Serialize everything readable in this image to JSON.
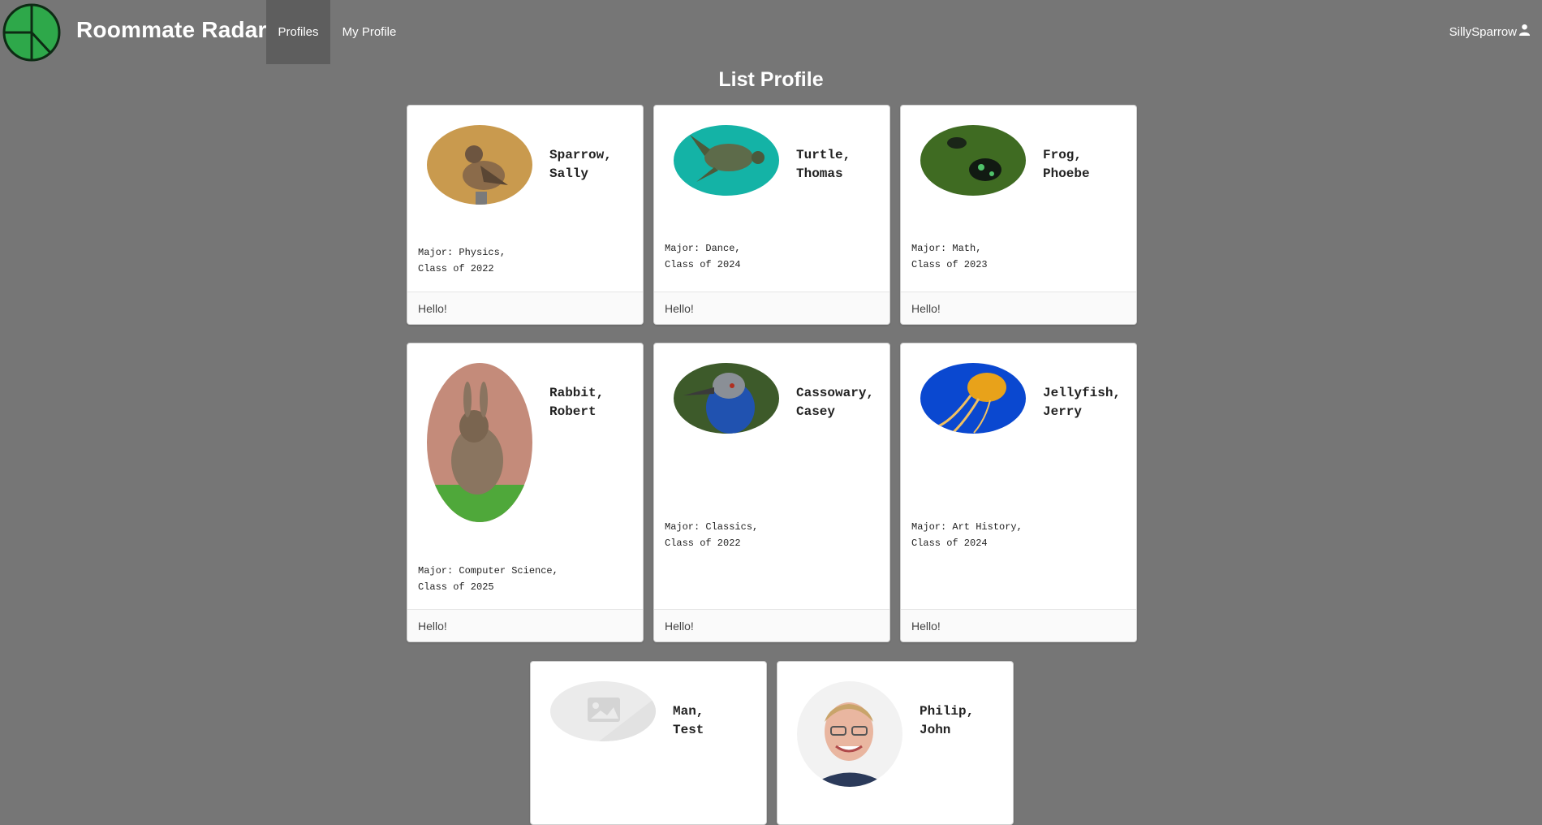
{
  "app": {
    "brand": "Roommate Radar",
    "nav": {
      "profiles": "Profiles",
      "my_profile": "My Profile"
    },
    "user": {
      "name": "SillySparrow"
    }
  },
  "page": {
    "title": "List Profile"
  },
  "profiles": [
    {
      "name_line1": "Sparrow,",
      "name_line2": "Sally",
      "desc_line1": "Major: Physics,",
      "desc_line2": "Class of 2022",
      "footer": "Hello!",
      "image": "sparrow"
    },
    {
      "name_line1": "Turtle,",
      "name_line2": "Thomas",
      "desc_line1": "Major: Dance,",
      "desc_line2": "Class of 2024",
      "footer": "Hello!",
      "image": "turtle"
    },
    {
      "name_line1": "Frog,",
      "name_line2": "Phoebe",
      "desc_line1": "Major: Math,",
      "desc_line2": "Class of 2023",
      "footer": "Hello!",
      "image": "frog"
    },
    {
      "name_line1": "Rabbit,",
      "name_line2": "Robert",
      "desc_line1": "Major: Computer Science,",
      "desc_line2": "Class of 2025",
      "footer": "Hello!",
      "image": "rabbit"
    },
    {
      "name_line1": "Cassowary,",
      "name_line2": "Casey",
      "desc_line1": "Major: Classics,",
      "desc_line2": "Class of 2022",
      "footer": "Hello!",
      "image": "cassowary"
    },
    {
      "name_line1": "Jellyfish,",
      "name_line2": "Jerry",
      "desc_line1": "Major: Art History,",
      "desc_line2": "Class of 2024",
      "footer": "Hello!",
      "image": "jellyfish"
    },
    {
      "name_line1": "Man,",
      "name_line2": "Test",
      "image": "placeholder"
    },
    {
      "name_line1": "Philip,",
      "name_line2": "John",
      "image": "person"
    }
  ]
}
